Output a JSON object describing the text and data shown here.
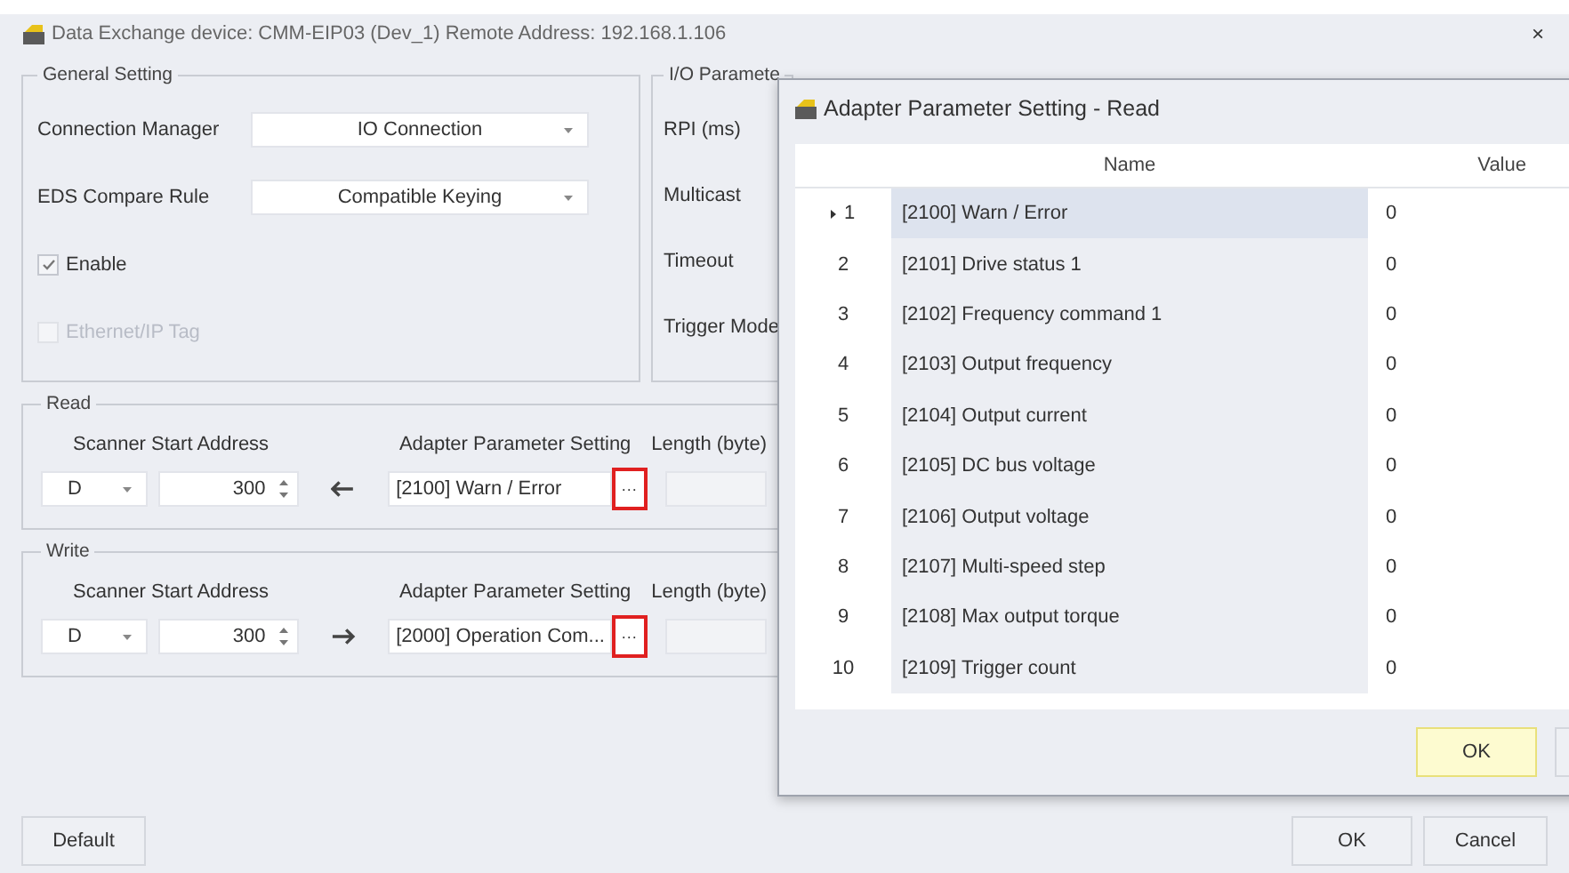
{
  "window": {
    "title": "Data Exchange  device: CMM-EIP03 (Dev_1)  Remote Address: 192.168.1.106",
    "close": "×"
  },
  "general_setting": {
    "title": "General Setting",
    "fields": [
      {
        "label": "Connection Manager",
        "value": "IO Connection"
      },
      {
        "label": "EDS Compare Rule",
        "value": "Compatible Keying"
      }
    ],
    "checkboxes": [
      {
        "label": "Enable",
        "checked": true,
        "disabled": false
      },
      {
        "label": "Ethernet/IP Tag",
        "checked": false,
        "disabled": true
      }
    ]
  },
  "io_parameters": {
    "title": "I/O Paramete",
    "labels": [
      "RPI (ms)",
      "Multicast",
      "Timeout",
      "Trigger Mode"
    ]
  },
  "sections": [
    {
      "title": "Read",
      "scanner_label": "Scanner Start Address",
      "device": "D",
      "address": "300",
      "kind": "read",
      "adapter_label": "Adapter Parameter Setting",
      "adapter_value": "[2100] Warn / Error",
      "browse": "···",
      "length_label": "Length (byte)"
    },
    {
      "title": "Write",
      "scanner_label": "Scanner Start Address",
      "device": "D",
      "address": "300",
      "kind": "write",
      "adapter_label": "Adapter Parameter Setting",
      "adapter_value": "[2000] Operation Com...",
      "browse": "···",
      "length_label": "Length (byte)"
    }
  ],
  "buttons": {
    "default": "Default",
    "ok": "OK",
    "cancel": "Cancel"
  },
  "dialog": {
    "title": "Adapter Parameter Setting - Read",
    "columns": [
      "Name",
      "Value"
    ],
    "rows": [
      {
        "index": "1",
        "name": "[2100] Warn / Error",
        "value": "0",
        "selected": true
      },
      {
        "index": "2",
        "name": "[2101] Drive status 1",
        "value": "0",
        "selected": false
      },
      {
        "index": "3",
        "name": "[2102] Frequency command 1",
        "value": "0",
        "selected": false
      },
      {
        "index": "4",
        "name": "[2103] Output frequency",
        "value": "0",
        "selected": false
      },
      {
        "index": "5",
        "name": "[2104] Output current",
        "value": "0",
        "selected": false
      },
      {
        "index": "6",
        "name": "[2105] DC bus voltage",
        "value": "0",
        "selected": false
      },
      {
        "index": "7",
        "name": "[2106] Output voltage",
        "value": "0",
        "selected": false
      },
      {
        "index": "8",
        "name": "[2107] Multi-speed step",
        "value": "0",
        "selected": false
      },
      {
        "index": "9",
        "name": "[2108] Max output torque",
        "value": "0",
        "selected": false
      },
      {
        "index": "10",
        "name": "[2109] Trigger count",
        "value": "0",
        "selected": false
      }
    ],
    "ok": "OK"
  }
}
